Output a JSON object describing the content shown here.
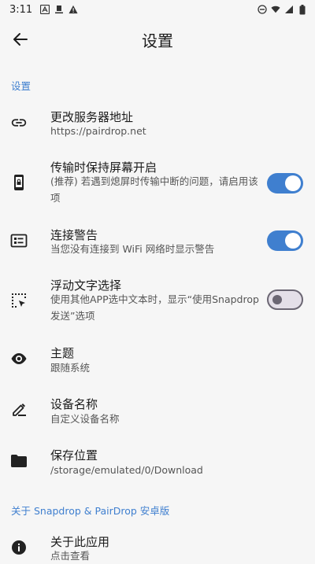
{
  "status": {
    "time": "3:11"
  },
  "header": {
    "title": "设置"
  },
  "sections": {
    "settings_label": "设置",
    "about_label": "关于 Snapdrop & PairDrop 安卓版"
  },
  "items": {
    "server": {
      "title": "更改服务器地址",
      "subtitle": "https://pairdrop.net",
      "icon": "link-icon"
    },
    "keep_screen": {
      "title": "传输时保持屏幕开启",
      "subtitle": "(推荐) 若遇到熄屏时传输中断的问题，请启用该项",
      "icon": "phone-lock-icon",
      "enabled": true
    },
    "connect_warning": {
      "title": "连接警告",
      "subtitle": "当您没有连接到 WiFi 网络时显示警告",
      "icon": "card-icon",
      "enabled": true
    },
    "floating_text": {
      "title": "浮动文字选择",
      "subtitle": "使用其他APP选中文本时，显示“使用Snapdrop发送”选项",
      "icon": "selection-icon",
      "enabled": false
    },
    "theme": {
      "title": "主题",
      "subtitle": "跟随系统",
      "icon": "eye-icon"
    },
    "device_name": {
      "title": "设备名称",
      "subtitle": "自定义设备名称",
      "icon": "edit-icon"
    },
    "save_location": {
      "title": "保存位置",
      "subtitle": "/storage/emulated/0/Download",
      "icon": "folder-icon"
    },
    "about_app": {
      "title": "关于此应用",
      "subtitle": "点击查看",
      "icon": "info-icon"
    }
  },
  "colors": {
    "accent": "#3f7fcf",
    "background": "#f6f6f6"
  }
}
